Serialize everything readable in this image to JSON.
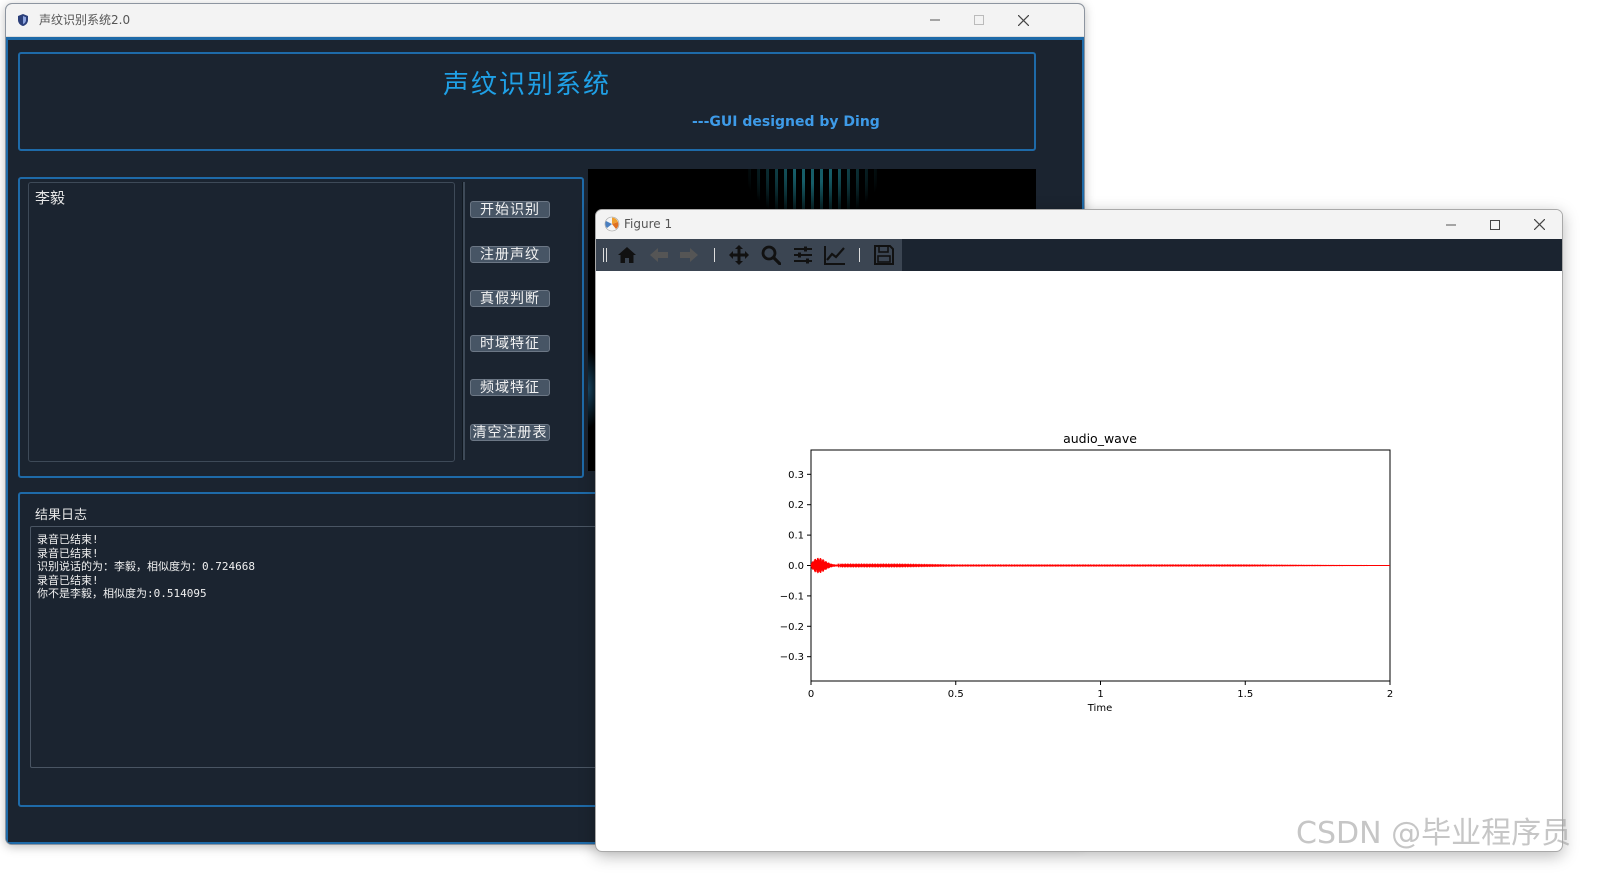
{
  "app_window": {
    "title": "声纹识别系统2.0",
    "heading": "声纹识别系统",
    "credit": "---GUI designed by Ding",
    "speaker_list": [
      "李毅"
    ],
    "buttons": {
      "start_recognition": "开始识别",
      "register_voiceprint": "注册声纹",
      "authenticity_check": "真假判断",
      "time_domain": "时域特征",
      "frequency_domain": "频域特征",
      "clear_registry": "清空注册表"
    },
    "log": {
      "title": "结果日志",
      "lines": [
        "录音已结束!",
        "录音已结束!",
        "识别说话的为：李毅，相似度为：0.724668",
        "录音已结束!",
        "你不是李毅，相似度为:0.514095"
      ]
    }
  },
  "figure_window": {
    "title": "Figure 1",
    "toolbar_icons": [
      "home-icon",
      "back-arrow-icon",
      "forward-arrow-icon",
      "pan-icon",
      "zoom-icon",
      "configure-subplots-icon",
      "edit-axes-icon",
      "save-icon"
    ]
  },
  "chart_data": {
    "type": "line",
    "title": "audio_wave",
    "xlabel": "Time",
    "ylabel": "",
    "xlim": [
      0,
      2
    ],
    "ylim": [
      -0.38,
      0.38
    ],
    "x_ticks": [
      "0",
      "0.5",
      "1",
      "1.5",
      "2"
    ],
    "y_ticks": [
      "0.3",
      "0.2",
      "0.1",
      "0.0",
      "−0.1",
      "−0.2",
      "−0.3"
    ],
    "series": [
      {
        "color": "#ff0000",
        "x": [
          0,
          0.01,
          0.02,
          0.03,
          0.04,
          0.05,
          0.06,
          0.07,
          0.08,
          0.1,
          0.3,
          0.5,
          1.0,
          1.5,
          2.0
        ],
        "y_envelope": [
          0.006,
          0.02,
          0.025,
          0.026,
          0.022,
          0.015,
          0.01,
          0.006,
          0.004,
          0.002,
          0.002,
          0.001,
          0.001,
          0.001,
          0.0
        ]
      }
    ],
    "grid": false,
    "legend": "none"
  },
  "watermark": "CSDN @毕业程序员"
}
